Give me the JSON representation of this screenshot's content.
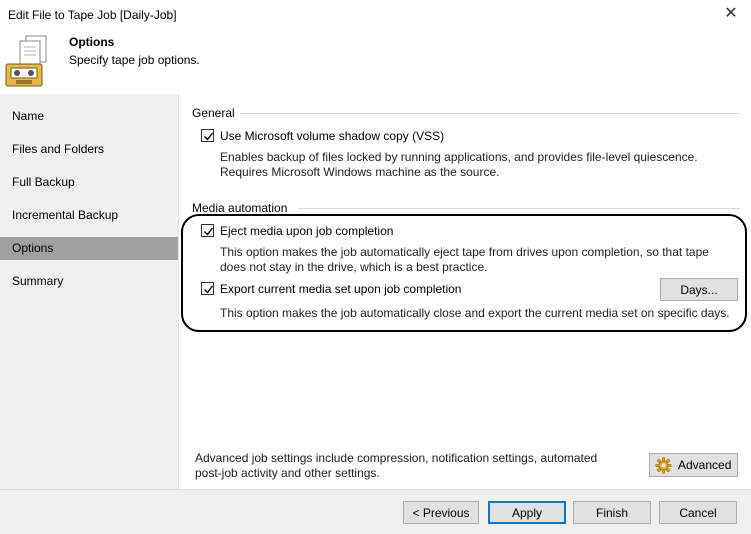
{
  "window": {
    "title": "Edit File to Tape Job [Daily-Job]"
  },
  "header": {
    "title": "Options",
    "subtitle": "Specify tape job options."
  },
  "sidebar": {
    "items": [
      {
        "label": "Name"
      },
      {
        "label": "Files and Folders"
      },
      {
        "label": "Full Backup"
      },
      {
        "label": "Incremental Backup"
      },
      {
        "label": "Options"
      },
      {
        "label": "Summary"
      }
    ],
    "active_index": 4
  },
  "general": {
    "section_label": "General",
    "vss_label": "Use Microsoft volume shadow copy (VSS)",
    "vss_checked": true,
    "vss_desc_line1": "Enables backup of files locked by running applications, and provides file-level quiescence.",
    "vss_desc_line2": "Requires Microsoft Windows machine as the source."
  },
  "media": {
    "section_label": "Media automation",
    "eject_label": "Eject media upon job completion",
    "eject_checked": true,
    "eject_desc_line1": "This option makes the job automatically eject tape from drives upon completion, so that tape",
    "eject_desc_line2": "does not stay in the drive, which is a best practice.",
    "export_label": "Export current media set upon job completion",
    "export_checked": true,
    "export_desc": "This option makes the job automatically close and export the current media set on specific days.",
    "days_button": "Days..."
  },
  "advanced": {
    "desc_line1": "Advanced job settings include compression, notification settings, automated",
    "desc_line2": "post-job activity and other settings.",
    "button": "Advanced"
  },
  "footer": {
    "previous": "< Previous",
    "apply": "Apply",
    "finish": "Finish",
    "cancel": "Cancel"
  },
  "colors": {
    "sidebar_bg": "#f0f0f0",
    "active_item_bg": "#a0a0a0",
    "button_bg": "#e1e1e1",
    "default_button_border": "#0078d7"
  }
}
